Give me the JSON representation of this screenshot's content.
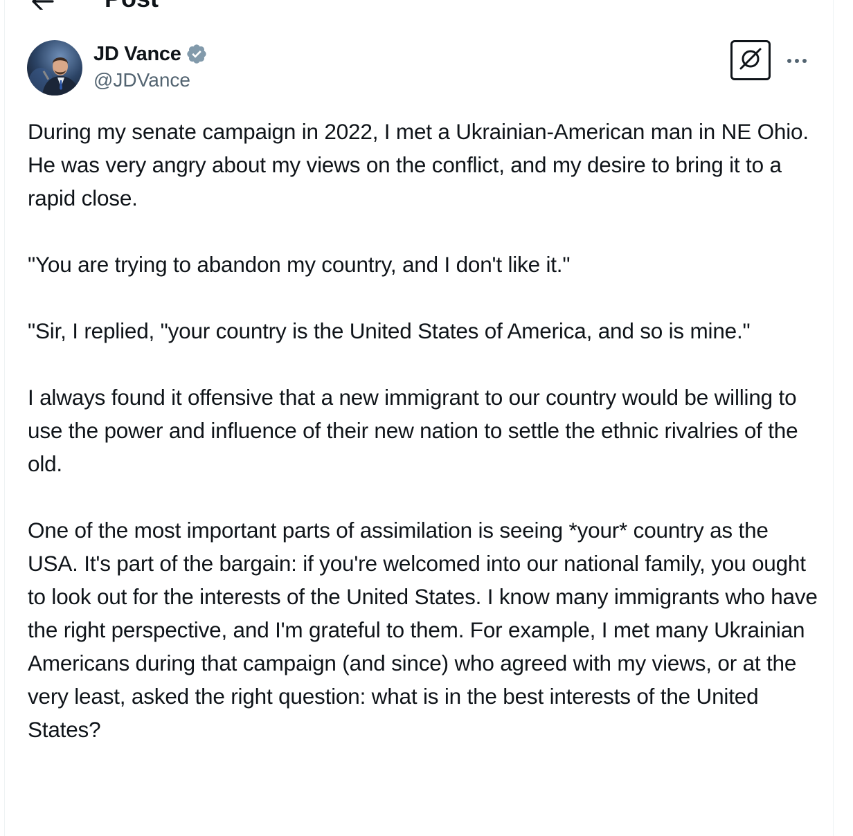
{
  "header": {
    "title": "Post"
  },
  "post": {
    "author": {
      "name": "JD Vance",
      "handle": "@JDVance",
      "verified": true
    },
    "paragraphs": [
      "During my senate campaign in 2022, I met a Ukrainian-American man in NE Ohio. He was very angry about my views on the conflict, and my desire to bring it to a rapid close.",
      "\"You are trying to abandon my country, and I don't like it.\"",
      "\"Sir, I replied, \"your country is the United States of America, and so is mine.\"",
      "I always found it offensive that a new immigrant to our country would be willing to use the power and influence of their new nation to settle the ethnic rivalries of the old.",
      "One of the most important parts of assimilation is seeing *your* country as the USA. It's part of the bargain: if you're welcomed into our national family, you ought to look out for the interests of the United States.  I know many immigrants who have the right perspective, and I'm grateful to them. For example, I met many Ukrainian Americans during that campaign (and since) who agreed with my views, or at the very least, asked the right question: what is in the best interests of the United States?"
    ]
  },
  "icons": {
    "back": "arrow-left-icon",
    "verified": "verified-badge-icon",
    "grok": "grok-icon",
    "more": "more-horizontal-icon"
  },
  "colors": {
    "text": "#0f1419",
    "secondary_text": "#536471",
    "badge": "#829aab",
    "border": "#eff3f4"
  }
}
